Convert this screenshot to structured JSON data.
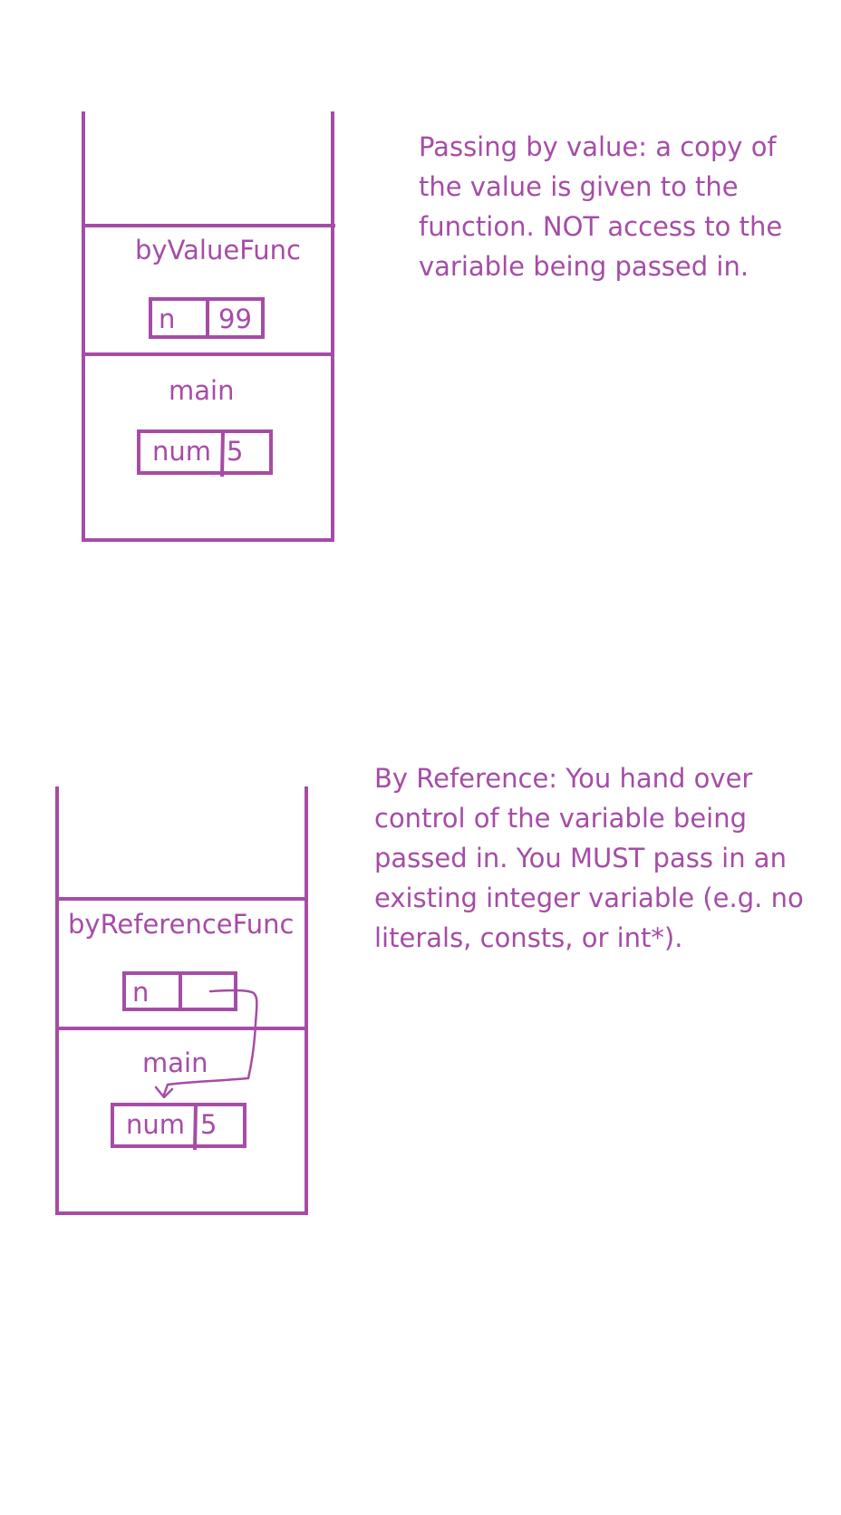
{
  "colors": {
    "ink": "#a64ca6",
    "background": "#ffffff"
  },
  "by_value": {
    "frame_label": "byValueFunc",
    "param": {
      "name": "n",
      "value": "99"
    },
    "caller_label": "main",
    "caller_var": {
      "name": "num",
      "value": "5"
    },
    "description": "Passing by value: a copy of\nthe value is given to the\nfunction. NOT access to the\nvariable being passed in."
  },
  "by_reference": {
    "frame_label": "byReferenceFunc",
    "param": {
      "name": "n"
    },
    "caller_label": "main",
    "caller_var": {
      "name": "num",
      "value": "5"
    },
    "description": "By Reference: You hand over\ncontrol of the variable being\npassed in. You MUST pass in an\nexisting integer variable (e.g. no\nliterals, consts, or int*)."
  }
}
